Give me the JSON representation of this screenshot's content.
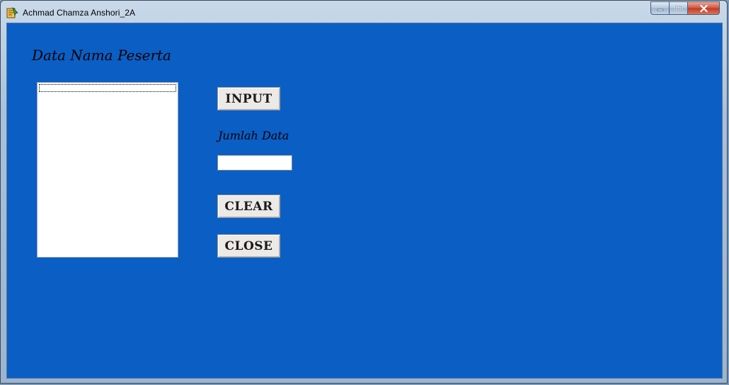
{
  "window": {
    "title": "Achmad Chamza Anshori_2A",
    "controls": {
      "minimize": "minimize",
      "maximize": "maximize",
      "close": "close"
    }
  },
  "form": {
    "heading": "Data Nama Peserta",
    "list_items": [],
    "buttons": {
      "input": "INPUT",
      "clear": "CLEAR",
      "close": "CLOSE"
    },
    "jumlah_label": "Jumlah Data",
    "jumlah_value": ""
  },
  "colors": {
    "client_bg": "#0b5ec4",
    "button_bg": "#ece9e6",
    "close_button": "#c23a21"
  },
  "icons": [
    "app-icon",
    "minimize-icon",
    "maximize-icon",
    "close-icon"
  ]
}
